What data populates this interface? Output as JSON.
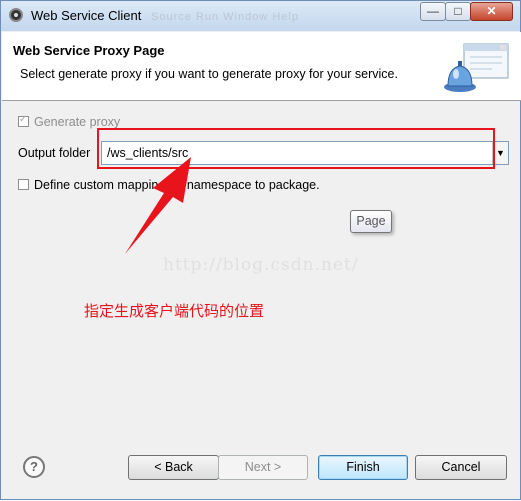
{
  "window": {
    "title": "Web Service Client",
    "ghost_menu": "Source   Run   Window   Help",
    "min_label": "—",
    "max_label": "□",
    "close_label": "✕"
  },
  "header": {
    "title": "Web Service Proxy Page",
    "description": "Select generate proxy if you want to generate proxy for your service.",
    "banner_icon": "service-bell-icon"
  },
  "form": {
    "generate_proxy": {
      "label": "Generate proxy",
      "checked": true,
      "enabled": false
    },
    "output_folder": {
      "label": "Output folder",
      "value": "/ws_clients/src"
    },
    "define_mapping": {
      "label": "Define custom mapping for namespace to package.",
      "checked": false
    }
  },
  "tooltip": "Page",
  "watermark": "http://blog.csdn.net/",
  "annotation": {
    "text": "指定生成客户端代码的位置",
    "color": "#e8141b"
  },
  "footer": {
    "help_icon": "help-icon",
    "help_label": "?",
    "back_label": "< Back",
    "next_label": "Next >",
    "finish_label": "Finish",
    "cancel_label": "Cancel"
  },
  "colors": {
    "highlight": "#e8141b",
    "accent": "#3c7fb1"
  }
}
